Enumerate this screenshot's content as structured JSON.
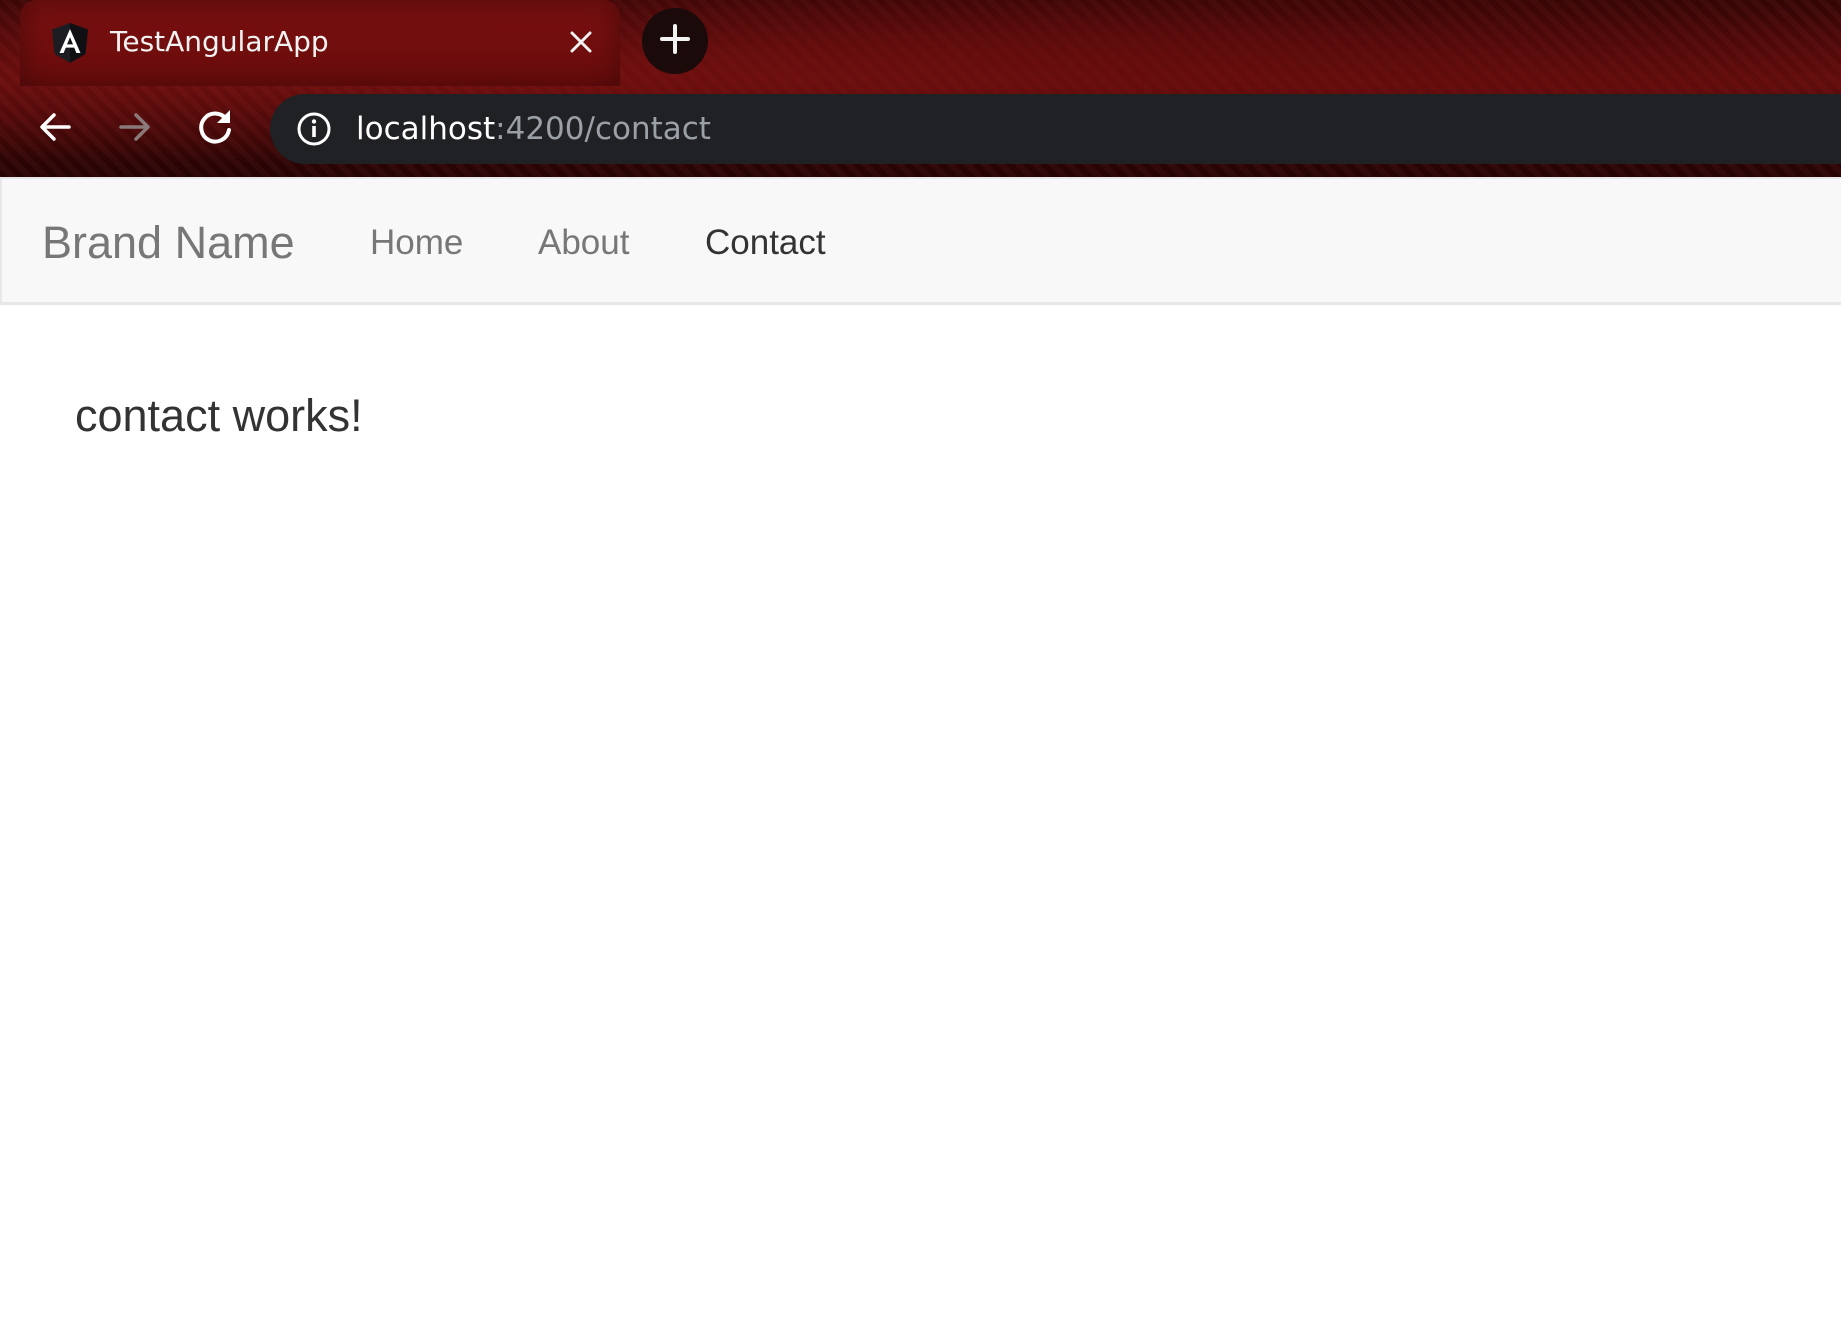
{
  "browser": {
    "tab": {
      "title": "TestAngularApp",
      "favicon": "angular-icon"
    },
    "address_bar": {
      "host": "localhost",
      "path": ":4200/contact"
    }
  },
  "navbar": {
    "brand": "Brand Name",
    "links": [
      {
        "label": "Home",
        "active": false
      },
      {
        "label": "About",
        "active": false
      },
      {
        "label": "Contact",
        "active": true
      }
    ]
  },
  "main": {
    "message": "contact works!"
  },
  "colors": {
    "navbar_bg": "#f8f8f8",
    "link_inactive": "#777777",
    "link_active": "#333333",
    "omnibox_bg": "#202124",
    "chrome_theme": "#5a0b0b"
  }
}
